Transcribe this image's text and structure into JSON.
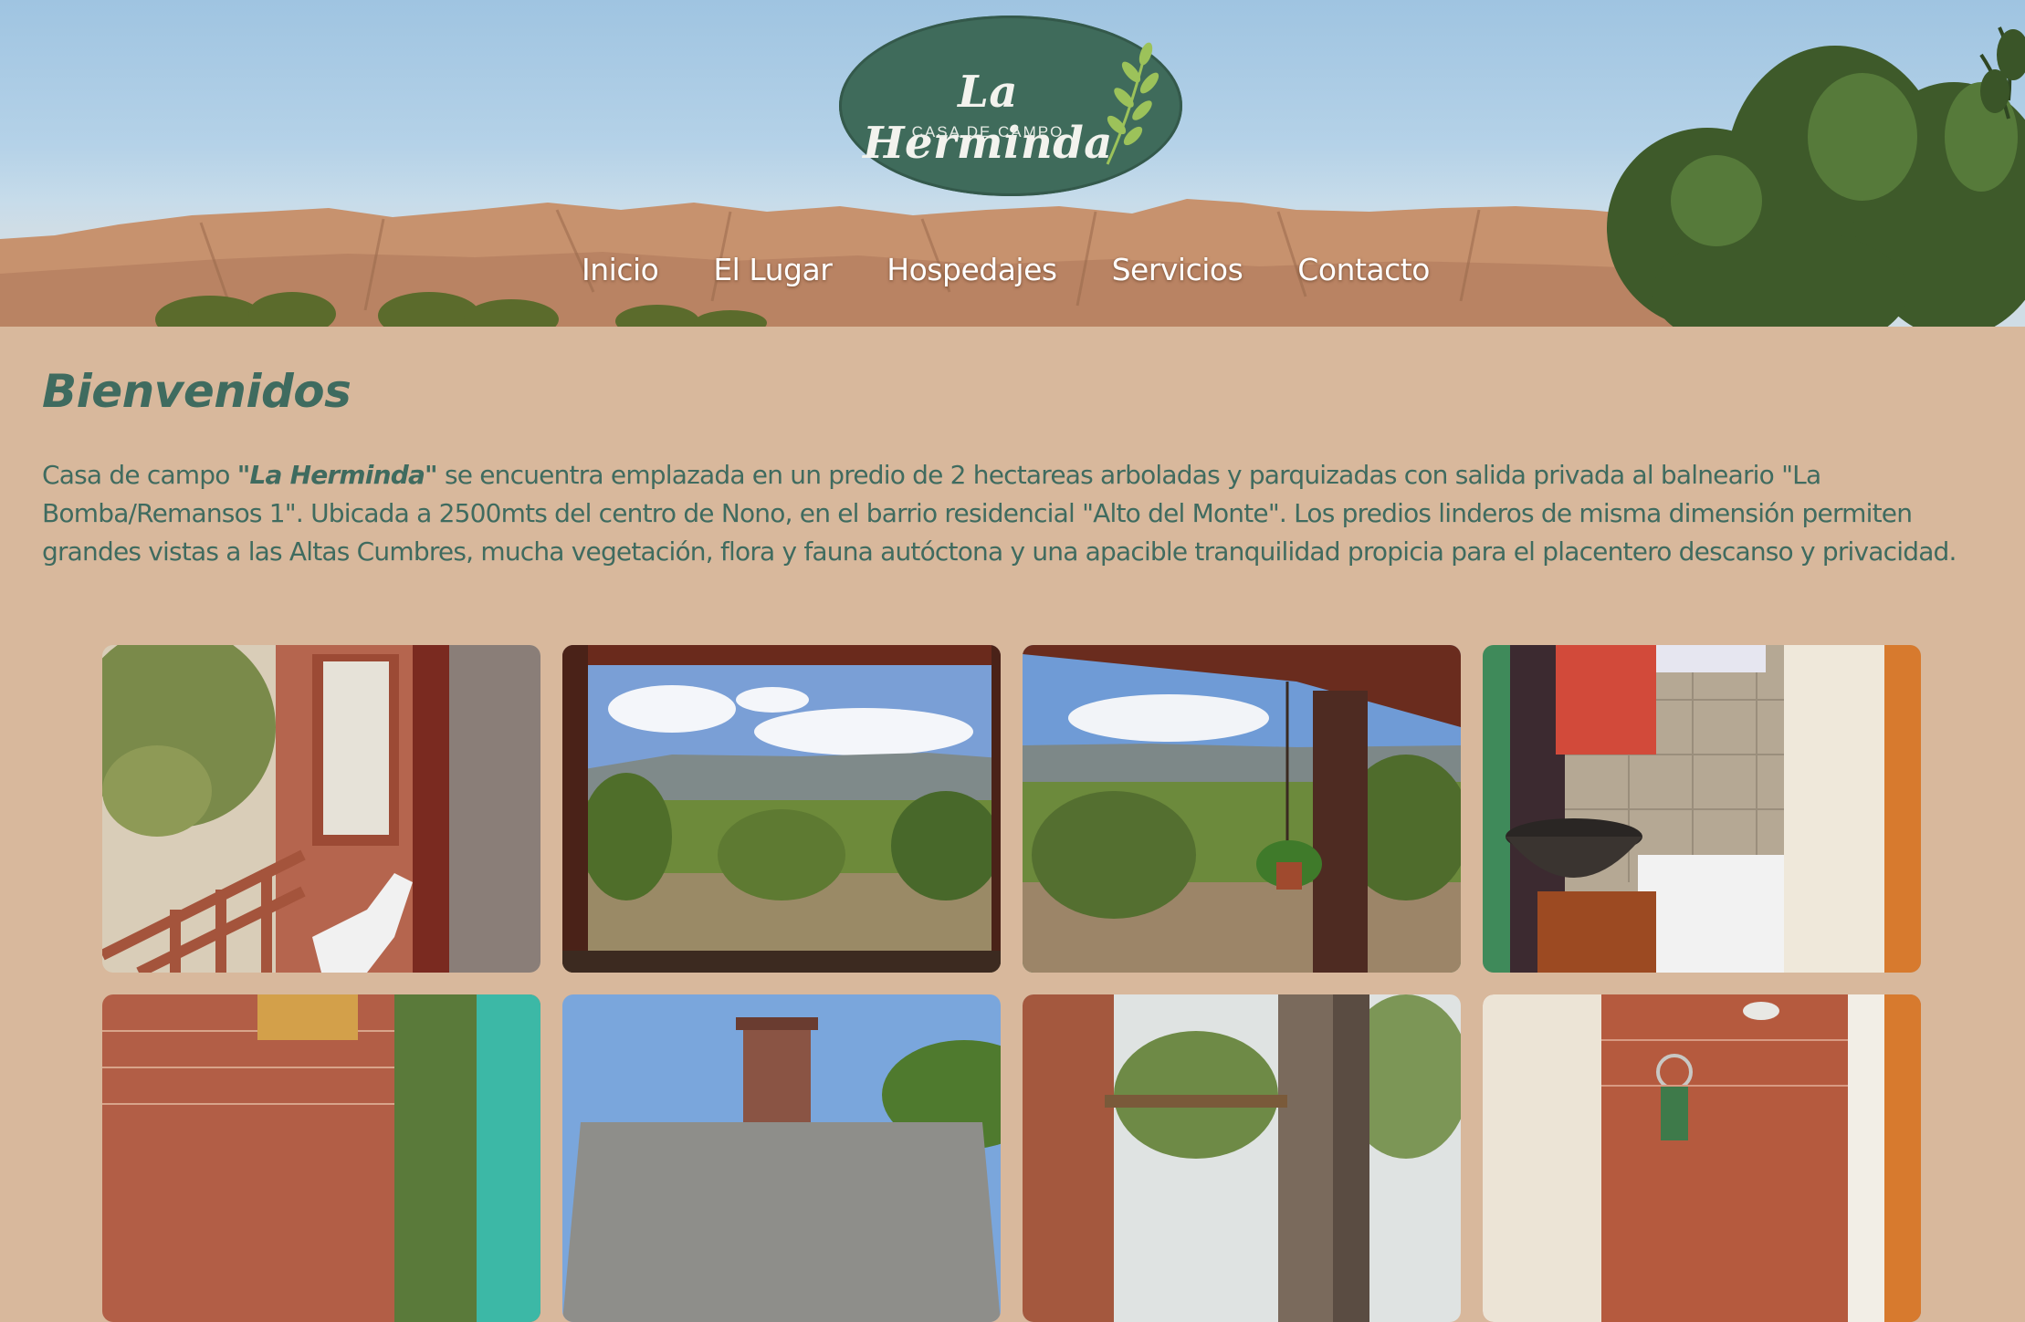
{
  "brand": {
    "name": "La Herminda",
    "tagline": "CASA DE CAMPO"
  },
  "nav": {
    "items": [
      {
        "label": "Inicio"
      },
      {
        "label": "El Lugar"
      },
      {
        "label": "Hospedajes"
      },
      {
        "label": "Servicios"
      },
      {
        "label": "Contacto"
      }
    ]
  },
  "welcome": {
    "title": "Bienvenidos",
    "intro_before": "Casa de campo ",
    "intro_brand": "\"La Herminda\"",
    "intro_after": " se encuentra emplazada en un predio de 2 hectareas arboladas y parquizadas con salida privada al balneario \"La Bomba/Remansos 1\". Ubicada a 2500mts del centro de Nono, en el barrio residencial \"Alto del Monte\". Los predios linderos de misma dimensión permiten grandes vistas a las Altas Cumbres, mucha vegetación, flora y fauna autóctona y una apacible tranquilidad propicia para el placentero descanso y privacidad."
  },
  "colors": {
    "page_bg": "#d8b89c",
    "accent_green": "#3f6b5f",
    "logo_green": "#3f6b5b",
    "nav_text": "#ffffff"
  },
  "gallery": {
    "photos": [
      {
        "subject": "brick-veranda-chair"
      },
      {
        "subject": "porch-mountain-view"
      },
      {
        "subject": "porch-hanging-plant"
      },
      {
        "subject": "bathroom-vessel-sink"
      },
      {
        "subject": "brick-wall-shelf"
      },
      {
        "subject": "chimney-roof"
      },
      {
        "subject": "garden-column"
      },
      {
        "subject": "bathroom-towel-ring"
      }
    ]
  }
}
